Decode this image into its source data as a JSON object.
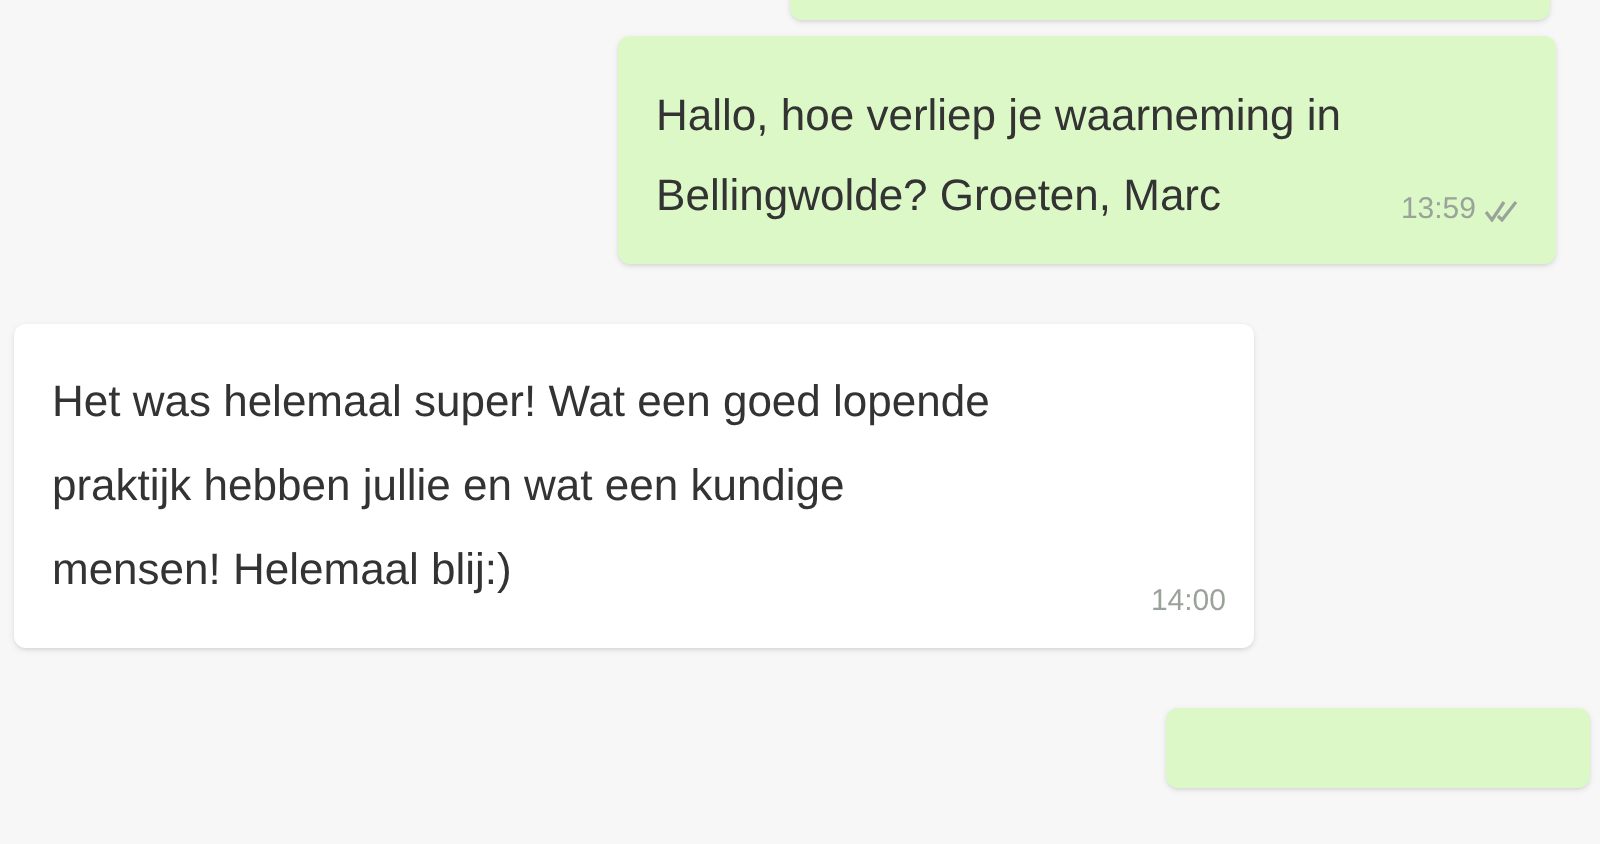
{
  "messages": [
    {
      "kind": "outgoing"
    },
    {
      "kind": "outgoing",
      "lines": [
        "Hallo, hoe verliep je waarneming in",
        "Bellingwolde? Groeten, Marc"
      ],
      "time": "13:59",
      "delivered": true
    },
    {
      "kind": "incoming",
      "lines": [
        "Het was helemaal super! Wat een goed lopende",
        "praktijk hebben jullie en wat een kundige",
        "mensen! Helemaal blij:)"
      ],
      "time": "14:00"
    },
    {
      "kind": "outgoing"
    }
  ]
}
